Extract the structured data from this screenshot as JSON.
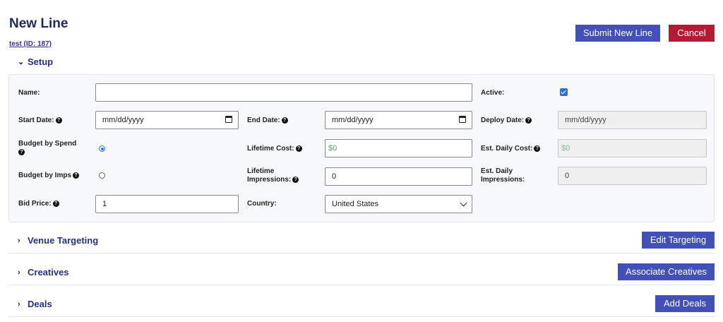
{
  "page": {
    "title": "New Line",
    "sublink": "test (ID: 187)"
  },
  "actions": {
    "submit_label": "Submit New Line",
    "cancel_label": "Cancel"
  },
  "sections": {
    "setup": "Setup",
    "venue": "Venue Targeting",
    "creatives": "Creatives",
    "deals": "Deals"
  },
  "section_buttons": {
    "edit_targeting": "Edit Targeting",
    "associate_creatives": "Associate Creatives",
    "add_deals": "Add Deals"
  },
  "form": {
    "name_label": "Name:",
    "name_value": "",
    "active_label": "Active:",
    "active_checked": true,
    "start_date_label": "Start Date:",
    "start_date_value": "mm/dd/yyyy",
    "end_date_label": "End Date:",
    "end_date_value": "mm/dd/yyyy",
    "deploy_date_label": "Deploy Date:",
    "deploy_date_value": "mm/dd/yyyy",
    "budget_spend_label": "Budget by Spend",
    "budget_spend_selected": true,
    "lifetime_cost_label": "Lifetime Cost:",
    "lifetime_cost_value": "$0",
    "est_daily_cost_label": "Est. Daily Cost:",
    "est_daily_cost_value": "$0",
    "budget_imps_label": "Budget by Imps",
    "budget_imps_selected": false,
    "lifetime_impressions_label_1": "Lifetime",
    "lifetime_impressions_label_2": "Impressions:",
    "lifetime_impressions_value": "0",
    "est_daily_impressions_label_1": "Est. Daily",
    "est_daily_impressions_label_2": "Impressions:",
    "est_daily_impressions_value": "0",
    "bid_price_label": "Bid Price:",
    "bid_price_value": "1",
    "country_label": "Country:",
    "country_value": "United States"
  },
  "icons": {
    "help": "?",
    "collapse": "chevron-down-icon",
    "expand": "chevron-right-icon"
  },
  "colors": {
    "primary": "#4250b8",
    "danger": "#b31b34",
    "heading": "#25317a",
    "checkbox": "#2f6fd6"
  }
}
